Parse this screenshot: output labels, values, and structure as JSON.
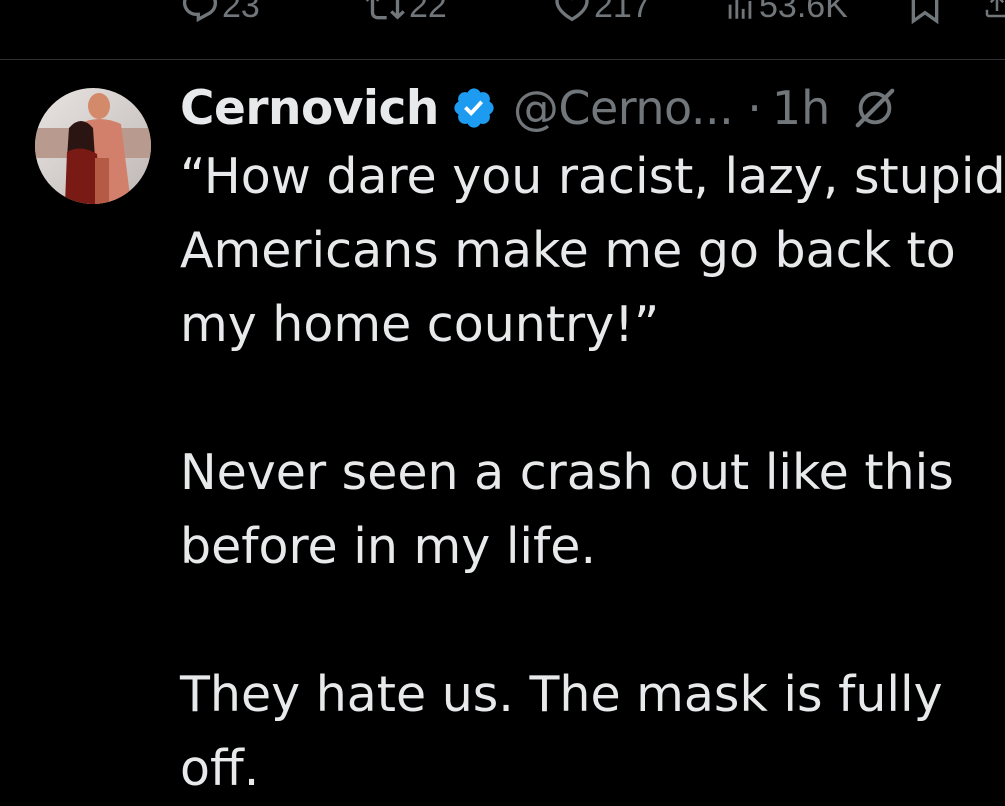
{
  "actions": {
    "reply_count": "23",
    "retweet_count": "22",
    "like_count": "217",
    "views_count": "53.6K"
  },
  "icons": {
    "reply": "comment-icon",
    "retweet": "retweet-icon",
    "like": "heart-icon",
    "views": "views-chart-icon",
    "bookmark": "bookmark-icon",
    "share": "share-icon",
    "verified": "verified-badge-icon",
    "grok": "grok-icon"
  },
  "colors": {
    "background": "#000000",
    "text_primary": "#e7e9ea",
    "text_secondary": "#71767b",
    "verified_blue": "#1d9bf0",
    "divider": "#2f3336"
  },
  "tweet": {
    "display_name": "Cernovich",
    "handle": "@Cerno...",
    "separator": "·",
    "time": "1h",
    "paragraphs": [
      {
        "lines": [
          "“How dare you racist, lazy, stupid",
          "Americans make me go back to",
          "my home country!”"
        ]
      },
      {
        "lines": [
          "Never seen a crash out like this",
          "before in my life."
        ]
      },
      {
        "lines": [
          "They hate us. The mask is fully",
          "off."
        ]
      }
    ]
  }
}
